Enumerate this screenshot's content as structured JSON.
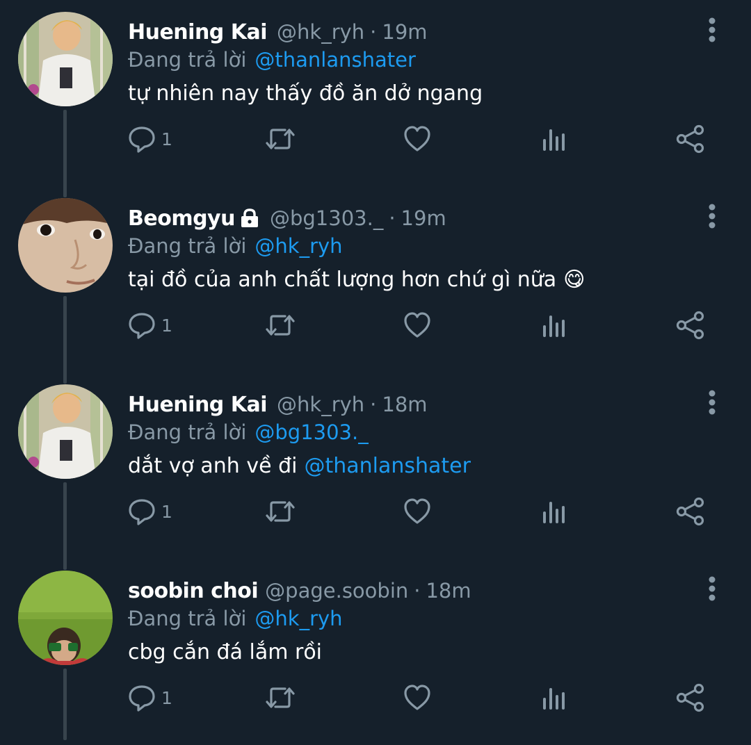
{
  "colors": {
    "background": "#15202b",
    "secondary_text": "#8899a6",
    "link": "#1d9bf0",
    "thread_line": "#38444d"
  },
  "tweets": [
    {
      "display_name": "Huening Kai",
      "locked": false,
      "handle": "@hk_ryh",
      "separator": "·",
      "time": "19m",
      "reply_prefix": "Đang trả lời",
      "reply_to": "@thanlanshater",
      "text": "tự nhiên nay thấy đồ ăn dở ngang",
      "mention": "",
      "emoji": "",
      "reply_count": "1",
      "avatar": "avatar-hueningkai"
    },
    {
      "display_name": "Beomgyu",
      "locked": true,
      "handle": "@bg1303._",
      "separator": "·",
      "time": "19m",
      "reply_prefix": "Đang trả lời",
      "reply_to": "@hk_ryh",
      "text": "tại đồ của anh chất lượng hơn chứ gì nữa",
      "mention": "",
      "emoji": "😋",
      "reply_count": "1",
      "avatar": "avatar-beomgyu"
    },
    {
      "display_name": "Huening Kai",
      "locked": false,
      "handle": "@hk_ryh",
      "separator": "·",
      "time": "18m",
      "reply_prefix": "Đang trả lời",
      "reply_to": "@bg1303._",
      "text": "dắt vợ anh về đi",
      "mention": "@thanlanshater",
      "emoji": "",
      "reply_count": "1",
      "avatar": "avatar-hueningkai"
    },
    {
      "display_name": "soobin choi",
      "locked": false,
      "handle": "@page.soobin",
      "separator": "·",
      "time": "18m",
      "reply_prefix": "Đang trả lời",
      "reply_to": "@hk_ryh",
      "text": "cbg cắn đá lắm rồi",
      "mention": "",
      "emoji": "",
      "reply_count": "1",
      "avatar": "avatar-soobin"
    }
  ],
  "icons": {
    "reply": "reply-icon",
    "retweet": "retweet-icon",
    "like": "heart-icon",
    "views": "analytics-icon",
    "share": "share-icon",
    "more": "more-vertical-icon",
    "lock": "lock-icon"
  }
}
